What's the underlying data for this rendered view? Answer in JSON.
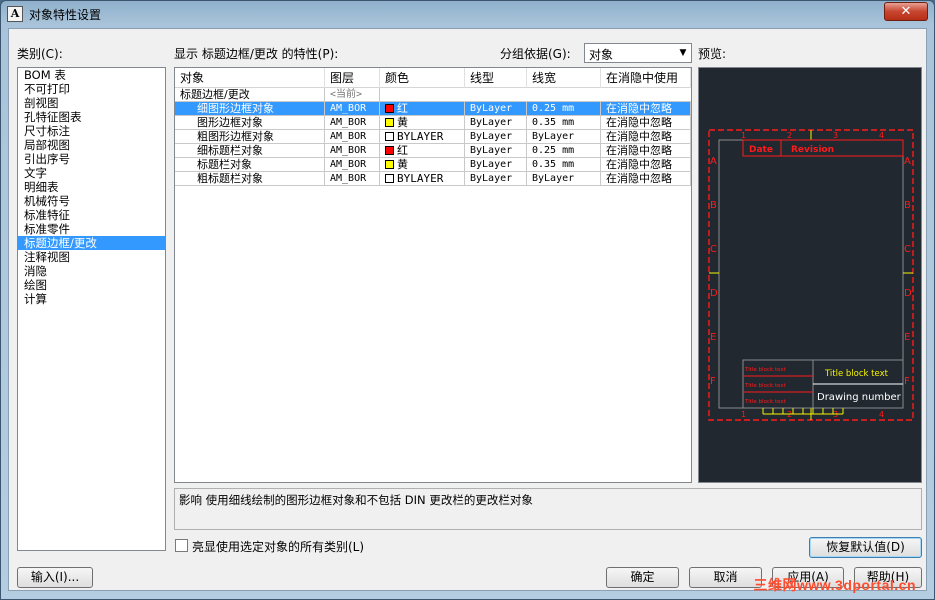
{
  "window": {
    "title": "对象特性设置",
    "app_icon": "A",
    "close_label": "✕"
  },
  "categories": {
    "label": "类别(C):",
    "items": [
      "BOM 表",
      "不可打印",
      "剖视图",
      "孔特征图表",
      "尺寸标注",
      "局部视图",
      "引出序号",
      "文字",
      "明细表",
      "机械符号",
      "标准特征",
      "标准零件",
      "标题边框/更改",
      "注释视图",
      "消隐",
      "绘图",
      "计算"
    ],
    "selected_index": 12
  },
  "properties": {
    "label": "显示 标题边框/更改 的特性(P):",
    "group_by_label": "分组依据(G):",
    "group_by_value": "对象",
    "preview_label": "预览:"
  },
  "grid": {
    "columns": [
      "对象",
      "图层",
      "颜色",
      "线型",
      "线宽",
      "在消隐中使用"
    ],
    "group_row": {
      "object": "标题边框/更改",
      "layer": "<当前>"
    },
    "rows": [
      {
        "object": "细图形边框对象",
        "layer": "AM_BOR",
        "color_name": "红",
        "color_hex": "#ff0000",
        "linetype": "ByLayer",
        "lineweight": "0.25 mm",
        "hidden": "在消隐中忽略",
        "selected": true
      },
      {
        "object": "图形边框对象",
        "layer": "AM_BOR",
        "color_name": "黄",
        "color_hex": "#ffff00",
        "linetype": "ByLayer",
        "lineweight": "0.35 mm",
        "hidden": "在消隐中忽略",
        "selected": false
      },
      {
        "object": "粗图形边框对象",
        "layer": "AM_BOR",
        "color_name": "BYLAYER",
        "color_hex": "#ffffff",
        "linetype": "ByLayer",
        "lineweight": "ByLayer",
        "hidden": "在消隐中忽略",
        "selected": false
      },
      {
        "object": "细标题栏对象",
        "layer": "AM_BOR",
        "color_name": "红",
        "color_hex": "#ff0000",
        "linetype": "ByLayer",
        "lineweight": "0.25 mm",
        "hidden": "在消隐中忽略",
        "selected": false
      },
      {
        "object": "标题栏对象",
        "layer": "AM_BOR",
        "color_name": "黄",
        "color_hex": "#ffff00",
        "linetype": "ByLayer",
        "lineweight": "0.35 mm",
        "hidden": "在消隐中忽略",
        "selected": false
      },
      {
        "object": "粗标题栏对象",
        "layer": "AM_BOR",
        "color_name": "BYLAYER",
        "color_hex": "#ffffff",
        "linetype": "ByLayer",
        "lineweight": "ByLayer",
        "hidden": "在消隐中忽略",
        "selected": false
      }
    ]
  },
  "preview": {
    "background": "#212830",
    "col_numbers": [
      "1",
      "2",
      "3",
      "4"
    ],
    "row_letters": [
      "A",
      "B",
      "C",
      "D",
      "E",
      "F"
    ],
    "header_date": "Date",
    "header_revision": "Revision",
    "title_block_small": "Title block text",
    "title_block_large": "Title block text",
    "drawing_number": "Drawing number",
    "colors": {
      "red": "#ff1a1a",
      "yellow": "#f5f500",
      "white": "#ffffff",
      "gray": "#8c8c8c"
    }
  },
  "info": {
    "text": "影响 使用细线绘制的图形边框对象和不包括 DIN 更改栏的更改栏对象"
  },
  "highlight_checkbox": {
    "label": "亮显使用选定对象的所有类别(L)",
    "checked": false
  },
  "buttons": {
    "restore_defaults": "恢复默认值(D)",
    "import": "输入(I)...",
    "ok": "确定",
    "cancel": "取消",
    "apply": "应用(A)",
    "help": "帮助(H)"
  },
  "watermark": "三维网www.3dportal.cn"
}
